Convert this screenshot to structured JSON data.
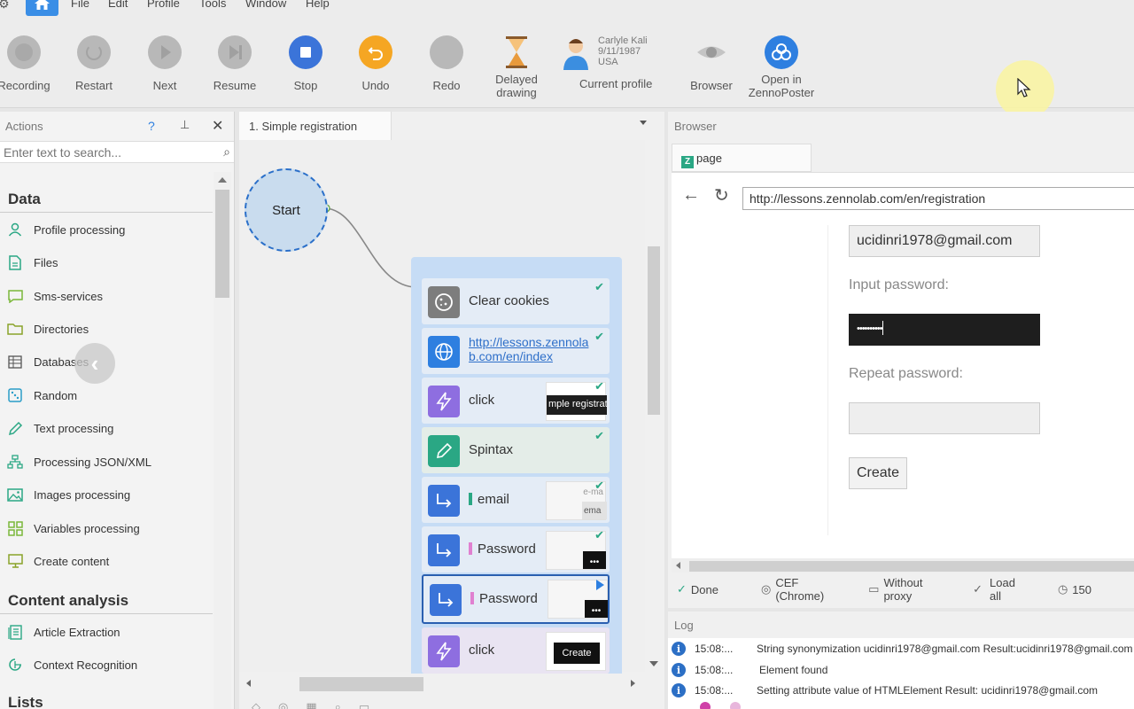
{
  "menu": {
    "items": [
      "File",
      "Edit",
      "Profile",
      "Tools",
      "Window",
      "Help"
    ]
  },
  "toolbar": {
    "recording": "Recording",
    "restart": "Restart",
    "next": "Next",
    "resume": "Resume",
    "stop": "Stop",
    "undo": "Undo",
    "redo": "Redo",
    "delayed_line1": "Delayed",
    "delayed_line2": "drawing",
    "profile_name": "Carlyle Kali",
    "profile_date": "9/11/1987",
    "profile_country": "USA",
    "current_profile": "Current profile",
    "browser": "Browser",
    "open_line1": "Open in",
    "open_line2": "ZennoPoster",
    "colors": {
      "stop": "#3b74d9",
      "undo": "#f5a623",
      "open": "#2e7fe0"
    }
  },
  "actions": {
    "title": "Actions",
    "help": "?",
    "search_placeholder": "Enter text to search...",
    "sections": [
      {
        "title": "Data",
        "items": [
          "Profile processing",
          "Files",
          "Sms-services",
          "Directories",
          "Databases",
          "Random",
          "Text processing",
          "Processing JSON/XML",
          "Images processing",
          "Variables processing",
          "Create content"
        ]
      },
      {
        "title": "Content analysis",
        "items": [
          "Article Extraction",
          "Context Recognition"
        ]
      },
      {
        "title": "Lists",
        "items": []
      }
    ]
  },
  "project": {
    "tab": "1. Simple registration",
    "start": "Start",
    "blocks": [
      {
        "label": "Clear cookies",
        "icon": "cookie-icon"
      },
      {
        "label": "http://lessons.zennolab.com/en/index",
        "line1": "http://lessons.zennola",
        "line2": "b.com/en/index",
        "icon": "globe-icon"
      },
      {
        "label": "click",
        "thumb": "mple registrat",
        "icon": "lightning-icon"
      },
      {
        "label": "Spintax",
        "icon": "pencil-icon"
      },
      {
        "label": "email",
        "thumb1": "e-ma",
        "thumb2": "ema",
        "icon": "arrow-icon"
      },
      {
        "label": "Password",
        "icon": "arrow-icon"
      },
      {
        "label": "Password",
        "icon": "arrow-icon"
      },
      {
        "label": "click",
        "thumb": "Create",
        "icon": "lightning-icon"
      }
    ]
  },
  "browser": {
    "title": "Browser",
    "tab": "page",
    "url": "http://lessons.zennolab.com/en/registration",
    "email_value": "ucidinri1978@gmail.com",
    "input_password_label": "Input password:",
    "password_mask": "••••••••••",
    "repeat_password_label": "Repeat password:",
    "create": "Create",
    "status": {
      "done": "Done",
      "engine": "CEF (Chrome)",
      "proxy": "Without proxy",
      "load": "Load all",
      "timeout": "150"
    }
  },
  "log": {
    "title": "Log",
    "rows": [
      {
        "time": "15:08:...",
        "text": "String synonymization ucidinri1978@gmail.com  Result:ucidinri1978@gmail.com"
      },
      {
        "time": "15:08:...",
        "text": "Element found"
      },
      {
        "time": "15:08:...",
        "text": "Setting attribute value of HTMLElement  Result: ucidinri1978@gmail.com"
      }
    ]
  }
}
